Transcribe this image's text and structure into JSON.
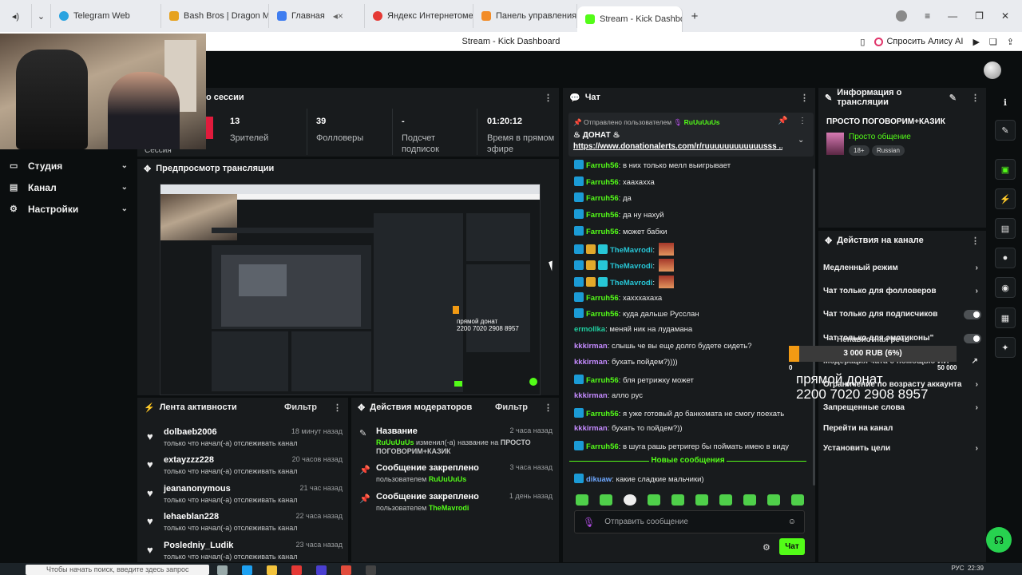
{
  "browser": {
    "tabs": [
      {
        "label": "Telegram Web",
        "color": "#2aa3e0"
      },
      {
        "label": "Bash Bros | Dragon Mone",
        "color": "#e6a21f"
      },
      {
        "label": "Главная",
        "color": "#3f7df0"
      },
      {
        "label": "Яндекс Интернетометр",
        "color": "#e53935"
      },
      {
        "label": "Панель управления - Don",
        "color": "#f28c28"
      },
      {
        "label": "Stream - Kick Dashboar",
        "color": "#53fc18"
      }
    ],
    "page_title": "Stream - Kick Dashboard",
    "alice_label": "Спросить Алису AI"
  },
  "sidebar": {
    "items": [
      {
        "label": "Студия"
      },
      {
        "label": "Канал"
      },
      {
        "label": "Настройки"
      }
    ]
  },
  "session": {
    "title_partial": "о сессии",
    "label_partial": "Сессия",
    "stats": [
      {
        "value": "13",
        "label": "Зрителей"
      },
      {
        "value": "39",
        "label": "Фолловеры"
      },
      {
        "value": "-",
        "label": "Подсчет подписок"
      },
      {
        "value": "01:20:12",
        "label": "Время в прямом эфире"
      }
    ]
  },
  "preview": {
    "title": "Предпросмотр трансляции",
    "donation_text": "прямой донат\n2200 7020 2908 8957"
  },
  "activity": {
    "title": "Лента активности",
    "filter": "Фильтр",
    "rows": [
      {
        "user": "dolbaeb2006",
        "time": "18 минут назад",
        "desc": "только что начал(-а) отслеживать канал"
      },
      {
        "user": "extayzzz228",
        "time": "20 часов назад",
        "desc": "только что начал(-а) отслеживать канал"
      },
      {
        "user": "jeananonymous",
        "time": "21 час назад",
        "desc": "только что начал(-а) отслеживать канал"
      },
      {
        "user": "lehaeblan228",
        "time": "22 часа назад",
        "desc": "только что начал(-а) отслеживать канал"
      },
      {
        "user": "Posledniy_Ludik",
        "time": "23 часа назад",
        "desc": "только что начал(-а) отслеживать канал"
      }
    ]
  },
  "mod_actions": {
    "title": "Действия модераторов",
    "filter": "Фильтр",
    "rows": [
      {
        "title": "Название",
        "time": "2 часа назад",
        "user": "RuUuUuUs",
        "desc_mid": " изменил(-а) название на ",
        "desc_end": "ПРОСТО ПОГОВОРИМ+КАЗИК"
      },
      {
        "title": "Сообщение закреплено",
        "time": "3 часа назад",
        "desc_pre": "пользователем ",
        "user": "RuUuUuUs"
      },
      {
        "title": "Сообщение закреплено",
        "time": "1 день назад",
        "desc_pre": "пользователем ",
        "user": "TheMavrodi"
      }
    ]
  },
  "chat": {
    "title": "Чат",
    "pinned_by_label": "Отправлено пользователем",
    "pinned_by_user": "RuUuUuUs",
    "pinned_text": "ДОНАТ",
    "pinned_link": "https://www.donationalerts.com/r/ruuuuuuuuuuuusss",
    "messages": [
      {
        "user": "Farruh56",
        "color": "#53fc18",
        "text": "в них только мелл выигрывает",
        "badge": "blue"
      },
      {
        "user": "Farruh56",
        "color": "#53fc18",
        "text": "хаахахха",
        "badge": "blue"
      },
      {
        "user": "Farruh56",
        "color": "#53fc18",
        "text": "да",
        "badge": "blue"
      },
      {
        "user": "Farruh56",
        "color": "#53fc18",
        "text": "да ну нахуй",
        "badge": "blue"
      },
      {
        "user": "Farruh56",
        "color": "#53fc18",
        "text": "может бабки",
        "badge": "blue"
      },
      {
        "user": "TheMavrodi",
        "color": "#27c6d6",
        "text": "",
        "badge": "mavrodi"
      },
      {
        "user": "TheMavrodi",
        "color": "#27c6d6",
        "text": "",
        "badge": "mavrodi"
      },
      {
        "user": "TheMavrodi",
        "color": "#27c6d6",
        "text": "",
        "badge": "mavrodi"
      },
      {
        "user": "Farruh56",
        "color": "#53fc18",
        "text": "хахххахаха",
        "badge": "blue"
      },
      {
        "user": "Farruh56",
        "color": "#53fc18",
        "text": "куда дальше Русслан",
        "badge": "blue"
      },
      {
        "user": "ermollka",
        "color": "#1fcfa0",
        "text": "меняй ник на лудамана",
        "badge": ""
      },
      {
        "user": "kkkirman",
        "color": "#c58bff",
        "text": "слышь че вы еще долго будете сидеть?",
        "badge": ""
      },
      {
        "user": "kkkirman",
        "color": "#c58bff",
        "text": "бухать пойдем?))))",
        "badge": ""
      },
      {
        "user": "Farruh56",
        "color": "#53fc18",
        "text": "бля ретрижку может",
        "badge": "blue"
      },
      {
        "user": "kkkirman",
        "color": "#c58bff",
        "text": "алло рус",
        "badge": ""
      },
      {
        "user": "Farruh56",
        "color": "#53fc18",
        "text": "я уже готовый до банкомата не смогу поехать",
        "badge": "blue"
      },
      {
        "user": "kkkirman",
        "color": "#c58bff",
        "text": "бухать то пойдем?))",
        "badge": ""
      },
      {
        "user": "Farruh56",
        "color": "#53fc18",
        "text": "в шуга рашь ретригер бы поймать имею в виду",
        "badge": "blue"
      }
    ],
    "new_messages_label": "Новые сообщения",
    "new_message": {
      "user": "dikuaw",
      "color": "#6ea8ff",
      "text": "какие сладкие мальчики)",
      "badge": "blue"
    },
    "input_placeholder": "Отправить сообщение",
    "send_label": "Чат"
  },
  "stream_info": {
    "title": "Информация о трансляции",
    "stream_title": "ПРОСТО ПОГОВОРИМ+КАЗИК",
    "category": "Просто общение",
    "tags": [
      "18+",
      "Russian"
    ]
  },
  "channel_actions": {
    "title": "Действия на канале",
    "items": [
      {
        "label": "Медленный режим",
        "control": "chevron"
      },
      {
        "label": "Чат только для фолловеров",
        "control": "chevron"
      },
      {
        "label": "Чат только для подписчиков",
        "control": "toggle"
      },
      {
        "label": "Чат только для эмотиконы\"",
        "control": "toggle"
      },
      {
        "label": "Модерация чата с помощью ИИ",
        "control": "external"
      },
      {
        "label": "Ограничение по возрасту аккаунта",
        "control": "chevron"
      },
      {
        "label": "Запрещенные слова",
        "control": "chevron"
      },
      {
        "label": "Перейти на канал",
        "control": "none"
      },
      {
        "label": "Установить цели",
        "control": "chevron"
      }
    ],
    "overlap_label": "Ненавистная речь"
  },
  "donation_goal": {
    "amount_label": "3 000 RUB (6%)",
    "progress": 0.06,
    "min": "0",
    "max": "50 000",
    "overlay_text": "прямой донат\n2200 7020 2908 8957"
  },
  "taskbar": {
    "search_placeholder": "Чтобы начать поиск, введите здесь запрос",
    "clock": "22:39",
    "lang": "РУС"
  }
}
